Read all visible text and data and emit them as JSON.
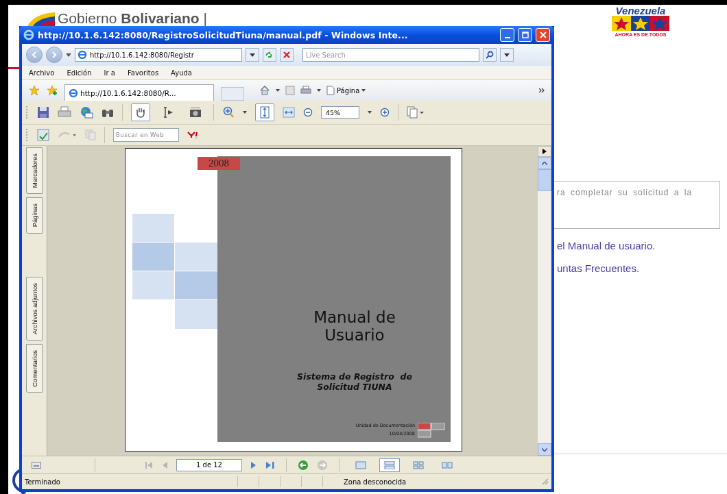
{
  "background_page": {
    "header_title": "Gobierno **Bolivariano** |",
    "logo": {
      "name": "Venezuela",
      "slogan": "AHORA ES DE TODOS"
    },
    "notice_text": "ra completar su solicitud a la",
    "links": [
      "el Manual de usuario.",
      "untas Frecuentes."
    ]
  },
  "browser_window": {
    "title": "http://10.1.6.142:8080/RegistroSolicitudTiuna/manual.pdf - Windows Inte...",
    "address": "http://10.1.6.142:8080/Registr",
    "search": {
      "placeholder": "Live Search"
    },
    "menu": [
      "Archivo",
      "Edición",
      "Ir a",
      "Favoritos",
      "Ayuda"
    ],
    "tab": {
      "label": "http://10.1.6.142:8080/R..."
    },
    "command_bar": {
      "page_label": "Página"
    },
    "pdf_toolbar": {
      "tools": [
        {
          "kind": "hand",
          "selected": true
        },
        {
          "kind": "select",
          "selected": false
        },
        {
          "kind": "snapshot",
          "selected": false
        }
      ],
      "fit_page": {
        "selected": true
      },
      "zoom": "45%",
      "web_search": {
        "placeholder": "Buscar en Web"
      }
    },
    "nav_tabs": [
      {
        "label": "Marcadores"
      },
      {
        "label": "Páginas"
      },
      {
        "label": "Archivos adjuntos"
      },
      {
        "label": "Comentarios"
      }
    ],
    "document": {
      "year": "2008",
      "title": "Manual de Usuario",
      "subtitle": "Sistema de Registro  de Solicitud TIUNA",
      "unit": "Unidad de Documentación",
      "date": "10/04/2008"
    },
    "page_nav": {
      "page": "1 de 12",
      "views": [
        {
          "kind": "single",
          "selected": false
        },
        {
          "kind": "continuous",
          "selected": true
        },
        {
          "kind": "facing",
          "selected": false
        },
        {
          "kind": "continuous_facing",
          "selected": false
        }
      ]
    },
    "status_bar": {
      "status": "Terminado",
      "zone": "Zona desconocida"
    }
  }
}
